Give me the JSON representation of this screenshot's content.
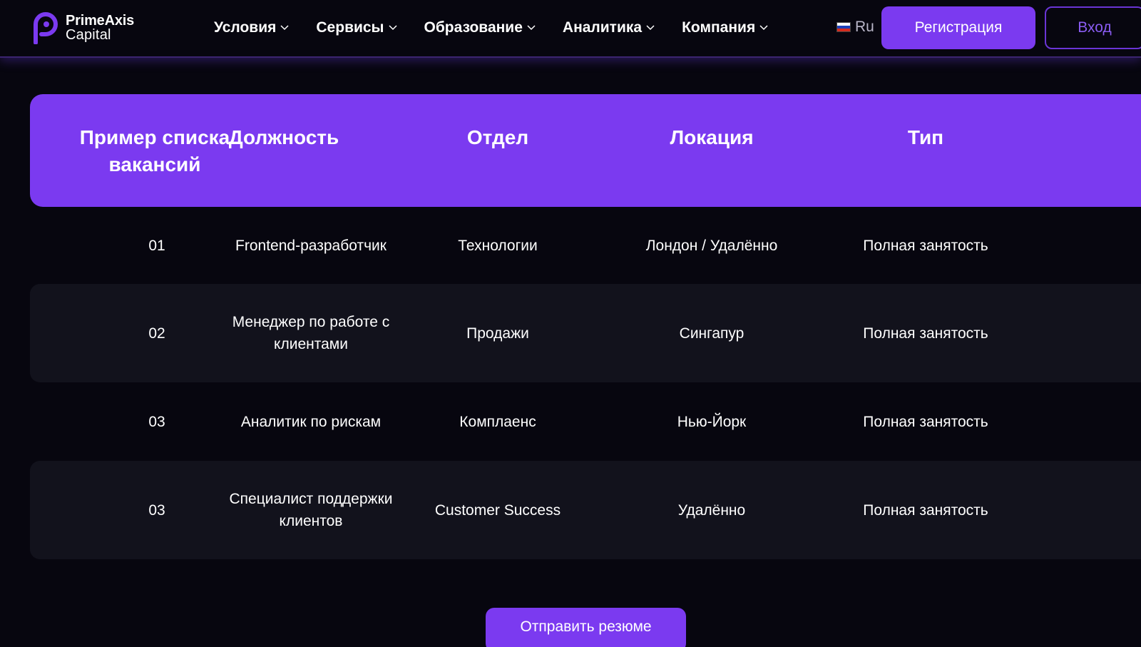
{
  "brand": {
    "name_line1": "PrimeAxis",
    "name_line2": "Capital",
    "accent_color": "#7b3af0",
    "logo_icon": "p-logo-icon"
  },
  "nav": {
    "items": [
      {
        "label": "Условия",
        "icon": "chevron-down-icon"
      },
      {
        "label": "Сервисы",
        "icon": "chevron-down-icon"
      },
      {
        "label": "Образование",
        "icon": "chevron-down-icon"
      },
      {
        "label": "Аналитика",
        "icon": "chevron-down-icon"
      },
      {
        "label": "Компания",
        "icon": "chevron-down-icon"
      }
    ]
  },
  "language": {
    "label": "Ru",
    "icon": "russia-flag-icon"
  },
  "auth": {
    "register_label": "Регистрация",
    "login_label": "Вход"
  },
  "table": {
    "headers": [
      "Пример списка вакансий",
      "Должность",
      "Отдел",
      "Локация",
      "Тип"
    ],
    "rows": [
      [
        "01",
        "Frontend-разработчик",
        "Технологии",
        "Лондон / Удалённо",
        "Полная занятость"
      ],
      [
        "02",
        "Менеджер по работе с клиентами",
        "Продажи",
        "Сингапур",
        "Полная занятость"
      ],
      [
        "03",
        "Аналитик по рискам",
        "Комплаенс",
        "Нью-Йорк",
        "Полная занятость"
      ],
      [
        "03",
        "Специалист поддержки клиентов",
        "Customer Success",
        "Удалённо",
        "Полная занятость"
      ]
    ]
  },
  "cta": {
    "submit_label": "Отправить резюме"
  }
}
